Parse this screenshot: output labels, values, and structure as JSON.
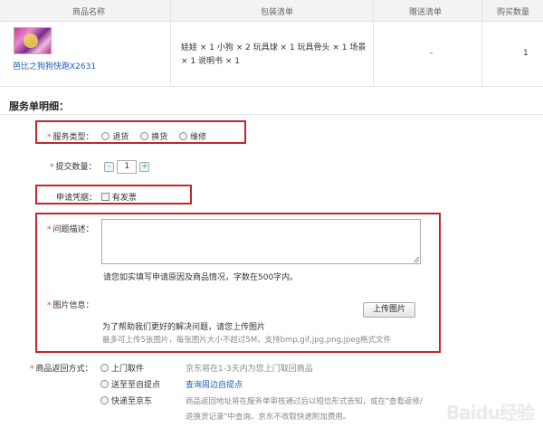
{
  "table": {
    "headers": [
      "商品名称",
      "包装清单",
      "赠送清单",
      "购买数量"
    ],
    "row": {
      "product_name": "芭比之狗狗快跑X2631",
      "package_list": "娃娃 × 1 小狗 × 2 玩具球 × 1 玩具骨头 × 1 场景 × 1 说明书 × 1",
      "gift": "-",
      "quantity": "1"
    }
  },
  "section": {
    "title": "服务单明细：",
    "service_type": {
      "label": "服务类型：",
      "options": [
        "退货",
        "换货",
        "维修"
      ]
    },
    "submit_qty": {
      "label": "提交数量：",
      "value": "1",
      "minus": "-",
      "plus": "+"
    },
    "proof": {
      "label": "申请凭据：",
      "option": "有发票"
    },
    "problem": {
      "label": "问题描述：",
      "hint": "请您如实填写申请原因及商品情况，字数在500字内。"
    },
    "images": {
      "label": "图片信息：",
      "upload_label": "上传图片",
      "hint1": "为了帮助我们更好的解决问题，请您上传图片",
      "hint2": "最多可上传5张图片，每张图片大小不超过5M，支持bmp,gif,jpg,png,jpeg格式文件"
    },
    "return_method": {
      "label": "商品返回方式：",
      "options": [
        {
          "label": "上门取件",
          "desc": "京东将在1-3天内为您上门取回商品"
        },
        {
          "label": "送至至自提点",
          "desc": "查询周边自提点"
        },
        {
          "label": "快递至京东",
          "desc": "商品返回地址将在服务单审核通过后以短信形式告知，或在\"查看返修/退换货记录\"中查询。京东不收取快递附加费用。"
        }
      ]
    }
  },
  "watermark": "Baidu经验",
  "colors": {
    "highlight": "#c1272d",
    "link": "#1a5fb4",
    "required": "#e4393c"
  }
}
